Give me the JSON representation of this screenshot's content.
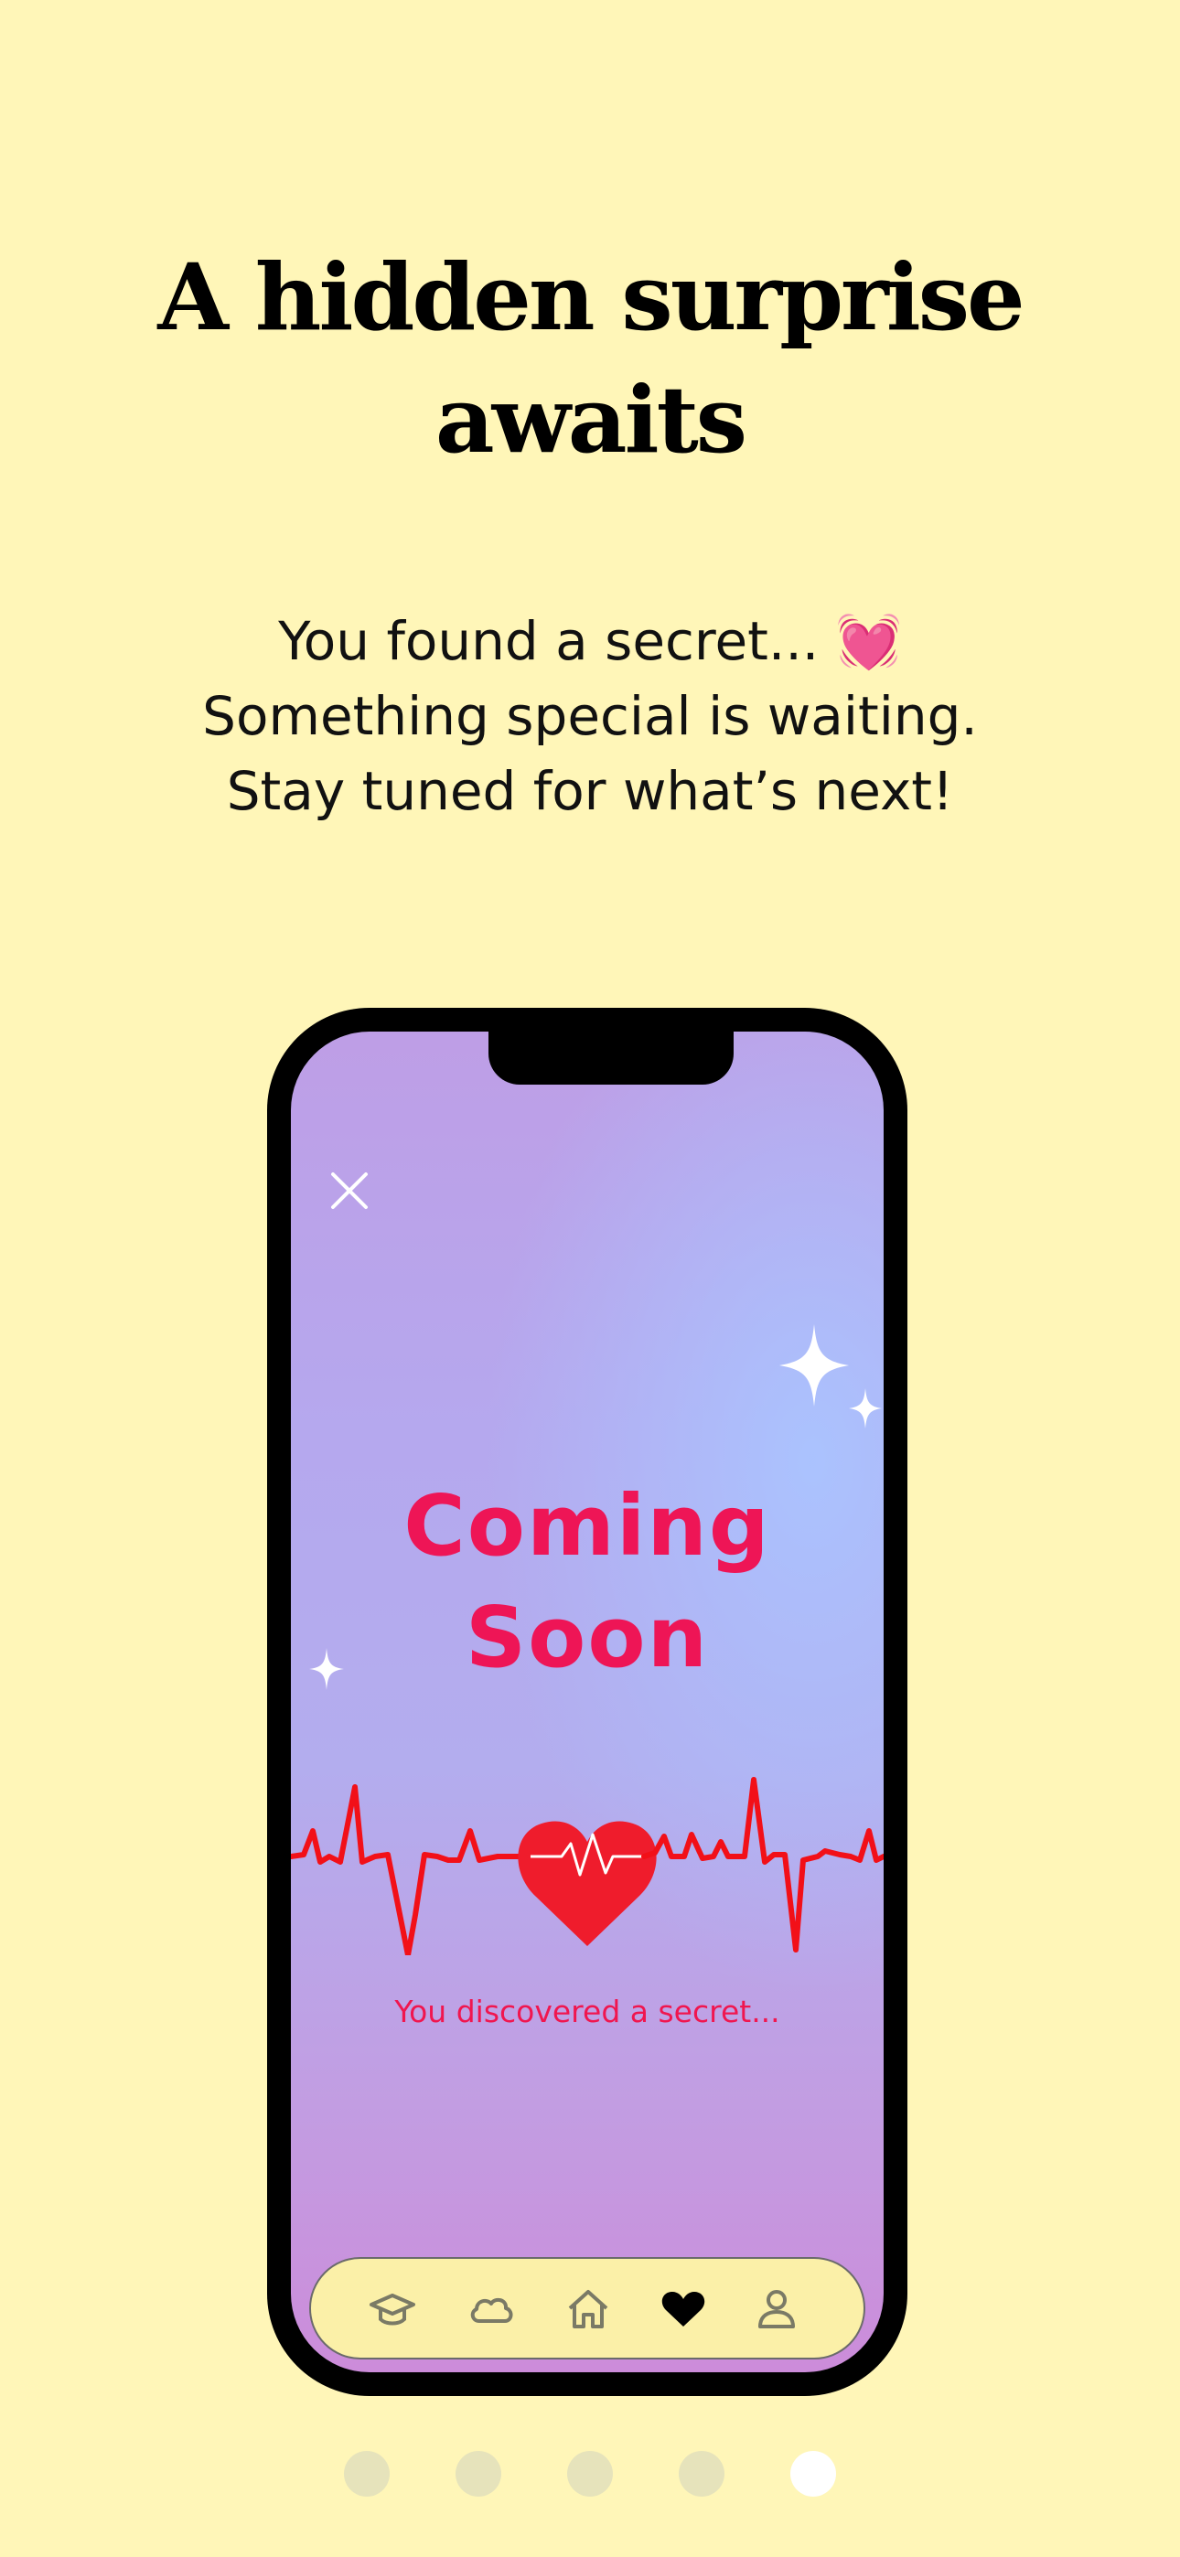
{
  "onboarding": {
    "headline": [
      "A hidden surprise",
      "awaits"
    ],
    "subtitle_lines": [
      "You found a secret... ",
      "Something special is waiting.",
      "Stay tuned for what’s next!"
    ],
    "subtitle_emoji": "💓"
  },
  "phone_preview": {
    "title_lines": [
      "Coming",
      "Soon"
    ],
    "message": "You discovered a secret...",
    "tabs": [
      "graduation-cap-icon",
      "cloud-icon",
      "home-icon",
      "heart-icon",
      "profile-icon"
    ],
    "active_tab": "heart-icon",
    "accent_color": "#EE1556",
    "heartbeat_color": "#F21018"
  },
  "pagination": {
    "total": 5,
    "active": 5
  },
  "colors": {
    "background": "#FFF6B8",
    "tabbar": "#FBF0A8"
  }
}
